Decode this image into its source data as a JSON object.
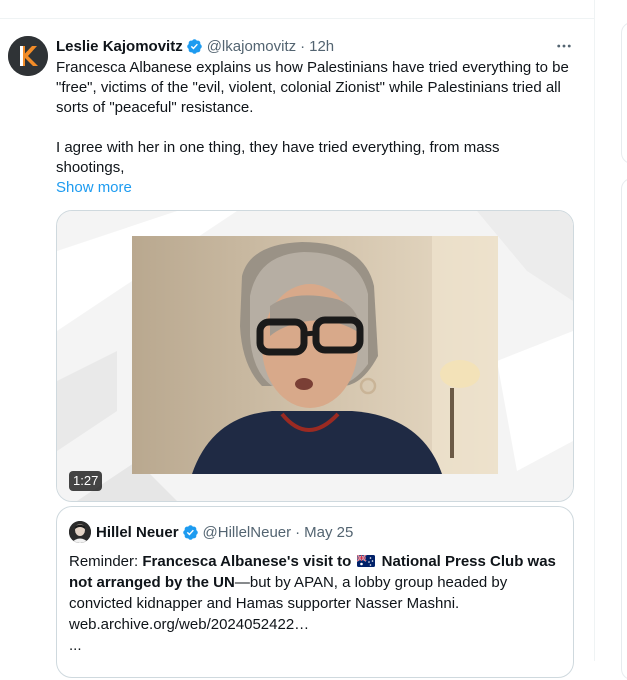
{
  "tweet": {
    "author_name": "Leslie Kajomovitz",
    "handle": "@lkajomovitz",
    "dot": "·",
    "time": "12h",
    "avatar_letter": "K",
    "text_line1": "Francesca Albanese explains us how Palestinians have tried everything to be \"free\", victims of the \"evil, violent, colonial Zionist\" while Palestinians tried all sorts of \"peaceful\" resistance.",
    "text_line2": "I agree with her in one thing, they have tried everything, from mass shootings,",
    "show_more": "Show more",
    "video_duration": "1:27"
  },
  "quote": {
    "author_name": "Hillel Neuer",
    "handle": "@HillelNeuer",
    "dot": "·",
    "time": "May 25",
    "reminder": "Reminder: ",
    "bold1": "Francesca Albanese's visit to",
    "bold2": "National Press Club was not arranged by the UN",
    "rest": "—but by APAN, a lobby group headed by convicted kidnapper and Hamas supporter Nasser Mashni.",
    "link": "web.archive.org/web/2024052422…",
    "ellipsis": "..."
  },
  "colors": {
    "accent": "#1d9bf0",
    "secondary_text": "#536471",
    "border": "#cfd9de"
  },
  "icons": {
    "verified": "verified-badge-icon",
    "more": "more-horizontal-icon",
    "flag": "australia-flag-icon"
  }
}
